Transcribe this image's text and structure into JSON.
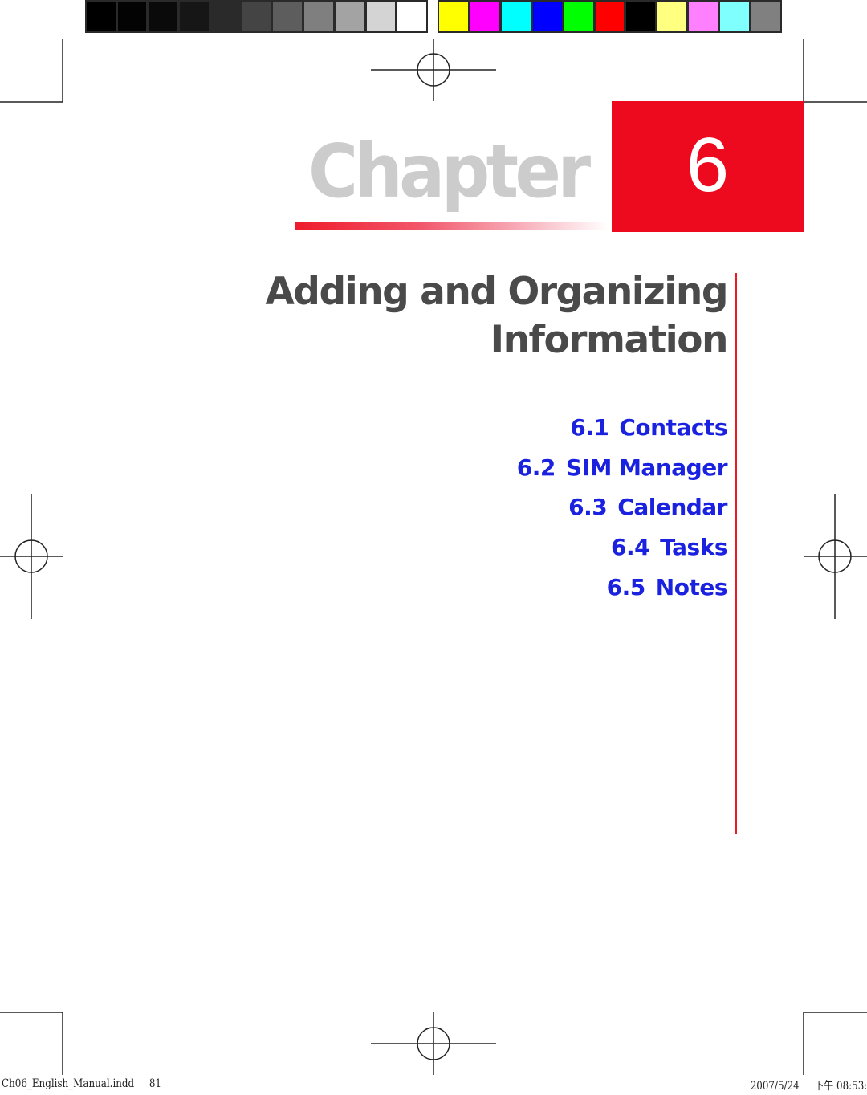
{
  "color_bar": {
    "grayscale": [
      "#000000",
      "#030303",
      "#0a0a0a",
      "#161616",
      "#2a2a2a",
      "#444444",
      "#5d5d5d",
      "#7f7f7f",
      "#a3a3a3",
      "#d4d4d4",
      "#ffffff"
    ],
    "colors": [
      "#ffff00",
      "#ff00ff",
      "#00ffff",
      "#0000ff",
      "#00ff00",
      "#ff0000",
      "#000000",
      "#ffff80",
      "#ff80ff",
      "#80ffff",
      "#808080"
    ]
  },
  "chapter": {
    "word": "Chapter",
    "number": "6",
    "accent_color": "#ee0a1e"
  },
  "title": {
    "line1": "Adding and Organizing",
    "line2": "Information"
  },
  "toc": [
    {
      "number": "6.1",
      "label": "Contacts"
    },
    {
      "number": "6.2",
      "label": "SIM Manager"
    },
    {
      "number": "6.3",
      "label": "Calendar"
    },
    {
      "number": "6.4",
      "label": "Tasks"
    },
    {
      "number": "6.5",
      "label": "Notes"
    }
  ],
  "slug": {
    "filename": "Ch06_English_Manual.indd",
    "page": "81",
    "date": "2007/5/24",
    "time": "下午 08:53:"
  }
}
